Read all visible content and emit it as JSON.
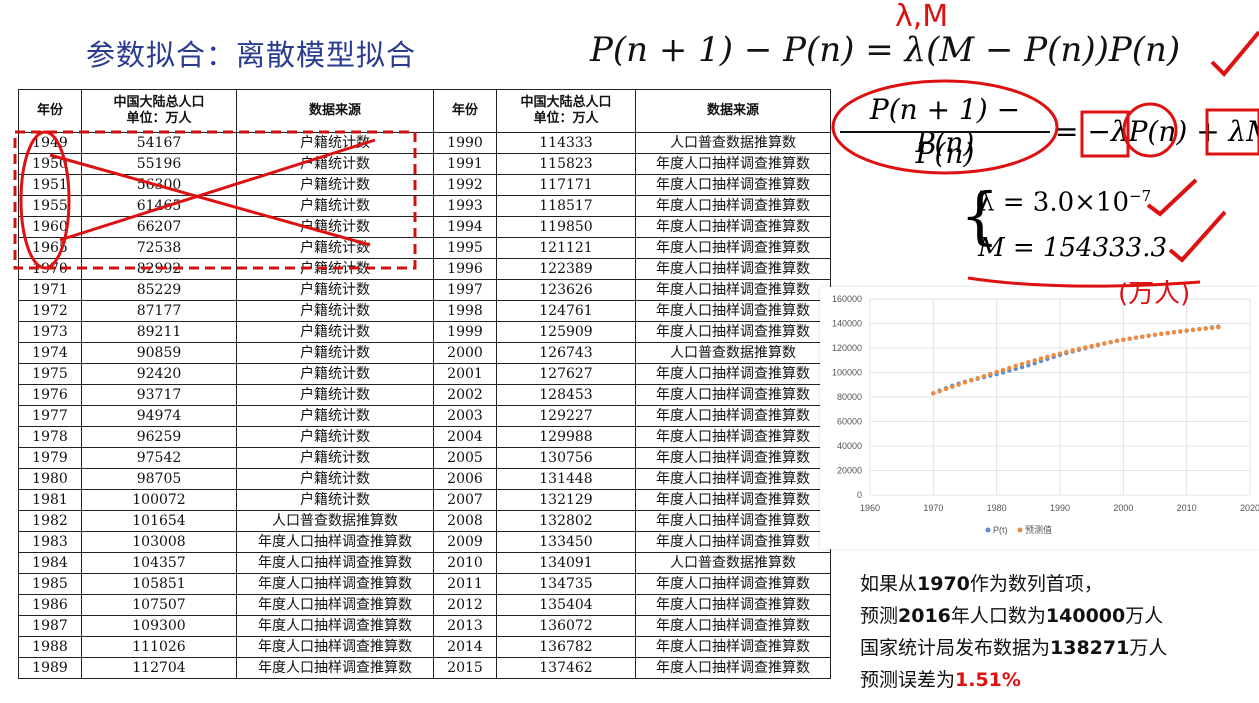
{
  "title": "参数拟合：离散模型拟合",
  "formula_main": "P(n + 1) − P(n) = λ(M − P(n))P(n)",
  "formula_frac_num": "P(n + 1) − P(n)",
  "formula_frac_den": "P(n)",
  "formula_rhs": "= −λP(n) + λM",
  "param_lambda": "λ = 3.0×10",
  "param_lambda_exp": "−7",
  "param_M": "M = 154333.3",
  "annotation_lm": "λ,M",
  "annotation_unit": "(万人)",
  "table": {
    "headers": [
      "年份",
      "中国大陆总人口\n单位：万人",
      "数据来源",
      "年份",
      "中国大陆总人口\n单位：万人",
      "数据来源"
    ],
    "rows": [
      [
        "1949",
        "54167",
        "户籍统计数",
        "1990",
        "114333",
        "人口普查数据推算数"
      ],
      [
        "1950",
        "55196",
        "户籍统计数",
        "1991",
        "115823",
        "年度人口抽样调查推算数"
      ],
      [
        "1951",
        "56300",
        "户籍统计数",
        "1992",
        "117171",
        "年度人口抽样调查推算数"
      ],
      [
        "1955",
        "61465",
        "户籍统计数",
        "1993",
        "118517",
        "年度人口抽样调查推算数"
      ],
      [
        "1960",
        "66207",
        "户籍统计数",
        "1994",
        "119850",
        "年度人口抽样调查推算数"
      ],
      [
        "1965",
        "72538",
        "户籍统计数",
        "1995",
        "121121",
        "年度人口抽样调查推算数"
      ],
      [
        "1970",
        "82992",
        "户籍统计数",
        "1996",
        "122389",
        "年度人口抽样调查推算数"
      ],
      [
        "1971",
        "85229",
        "户籍统计数",
        "1997",
        "123626",
        "年度人口抽样调查推算数"
      ],
      [
        "1972",
        "87177",
        "户籍统计数",
        "1998",
        "124761",
        "年度人口抽样调查推算数"
      ],
      [
        "1973",
        "89211",
        "户籍统计数",
        "1999",
        "125909",
        "年度人口抽样调查推算数"
      ],
      [
        "1974",
        "90859",
        "户籍统计数",
        "2000",
        "126743",
        "人口普查数据推算数"
      ],
      [
        "1975",
        "92420",
        "户籍统计数",
        "2001",
        "127627",
        "年度人口抽样调查推算数"
      ],
      [
        "1976",
        "93717",
        "户籍统计数",
        "2002",
        "128453",
        "年度人口抽样调查推算数"
      ],
      [
        "1977",
        "94974",
        "户籍统计数",
        "2003",
        "129227",
        "年度人口抽样调查推算数"
      ],
      [
        "1978",
        "96259",
        "户籍统计数",
        "2004",
        "129988",
        "年度人口抽样调查推算数"
      ],
      [
        "1979",
        "97542",
        "户籍统计数",
        "2005",
        "130756",
        "年度人口抽样调查推算数"
      ],
      [
        "1980",
        "98705",
        "户籍统计数",
        "2006",
        "131448",
        "年度人口抽样调查推算数"
      ],
      [
        "1981",
        "100072",
        "户籍统计数",
        "2007",
        "132129",
        "年度人口抽样调查推算数"
      ],
      [
        "1982",
        "101654",
        "人口普查数据推算数",
        "2008",
        "132802",
        "年度人口抽样调查推算数"
      ],
      [
        "1983",
        "103008",
        "年度人口抽样调查推算数",
        "2009",
        "133450",
        "年度人口抽样调查推算数"
      ],
      [
        "1984",
        "104357",
        "年度人口抽样调查推算数",
        "2010",
        "134091",
        "人口普查数据推算数"
      ],
      [
        "1985",
        "105851",
        "年度人口抽样调查推算数",
        "2011",
        "134735",
        "年度人口抽样调查推算数"
      ],
      [
        "1986",
        "107507",
        "年度人口抽样调查推算数",
        "2012",
        "135404",
        "年度人口抽样调查推算数"
      ],
      [
        "1987",
        "109300",
        "年度人口抽样调查推算数",
        "2013",
        "136072",
        "年度人口抽样调查推算数"
      ],
      [
        "1988",
        "111026",
        "年度人口抽样调查推算数",
        "2014",
        "136782",
        "年度人口抽样调查推算数"
      ],
      [
        "1989",
        "112704",
        "年度人口抽样调查推算数",
        "2015",
        "137462",
        "年度人口抽样调查推算数"
      ]
    ]
  },
  "chart": {
    "yticks": [
      "0",
      "20000",
      "40000",
      "60000",
      "80000",
      "100000",
      "120000",
      "140000",
      "160000"
    ],
    "xticks": [
      "1960",
      "1970",
      "1980",
      "1990",
      "2000",
      "2010",
      "2020"
    ],
    "legend": [
      "P(t)",
      "预测值"
    ],
    "colors": {
      "actual": "#5b8bd0",
      "predicted": "#f08a3c"
    }
  },
  "chart_data": {
    "type": "scatter",
    "xlim": [
      1960,
      2020
    ],
    "ylim": [
      0,
      160000
    ],
    "series": [
      {
        "name": "P(t)",
        "x": [
          1970,
          1971,
          1972,
          1973,
          1974,
          1975,
          1976,
          1977,
          1978,
          1979,
          1980,
          1981,
          1982,
          1983,
          1984,
          1985,
          1986,
          1987,
          1988,
          1989,
          1990,
          1991,
          1992,
          1993,
          1994,
          1995,
          1996,
          1997,
          1998,
          1999,
          2000,
          2001,
          2002,
          2003,
          2004,
          2005,
          2006,
          2007,
          2008,
          2009,
          2010,
          2011,
          2012,
          2013,
          2014,
          2015
        ],
        "values": [
          82992,
          85229,
          87177,
          89211,
          90859,
          92420,
          93717,
          94974,
          96259,
          97542,
          98705,
          100072,
          101654,
          103008,
          104357,
          105851,
          107507,
          109300,
          111026,
          112704,
          114333,
          115823,
          117171,
          118517,
          119850,
          121121,
          122389,
          123626,
          124761,
          125909,
          126743,
          127627,
          128453,
          129227,
          129988,
          130756,
          131448,
          132129,
          132802,
          133450,
          134091,
          134735,
          135404,
          136072,
          136782,
          137462
        ]
      },
      {
        "name": "预测值",
        "x": [
          1970,
          1971,
          1972,
          1973,
          1974,
          1975,
          1976,
          1977,
          1978,
          1979,
          1980,
          1981,
          1982,
          1983,
          1984,
          1985,
          1986,
          1987,
          1988,
          1989,
          1990,
          1991,
          1992,
          1993,
          1994,
          1995,
          1996,
          1997,
          1998,
          1999,
          2000,
          2001,
          2002,
          2003,
          2004,
          2005,
          2006,
          2007,
          2008,
          2009,
          2010,
          2011,
          2012,
          2013,
          2014,
          2015
        ],
        "values": [
          82992,
          84760,
          86540,
          88320,
          90090,
          91860,
          93610,
          95350,
          97070,
          98770,
          100450,
          102100,
          103730,
          105320,
          106880,
          108410,
          109900,
          111360,
          112780,
          114160,
          115500,
          116800,
          118060,
          119280,
          120460,
          121600,
          122700,
          123760,
          124780,
          125760,
          126700,
          127600,
          128470,
          129300,
          130100,
          130860,
          131590,
          132290,
          132960,
          133600,
          134210,
          134790,
          135350,
          135880,
          136390,
          136870
        ]
      }
    ]
  },
  "conclusion": {
    "line1_pre": "如果从",
    "line1_num": "1970",
    "line1_post": "作为数列首项，",
    "line2_pre": "预测",
    "line2_num1": "2016",
    "line2_mid": "年人口数为",
    "line2_num2": "140000",
    "line2_post": "万人",
    "line3_pre": "国家统计局发布数据为",
    "line3_num": "138271",
    "line3_post": "万人",
    "line4_pre": "预测误差为",
    "line4_num": "1.51%"
  }
}
